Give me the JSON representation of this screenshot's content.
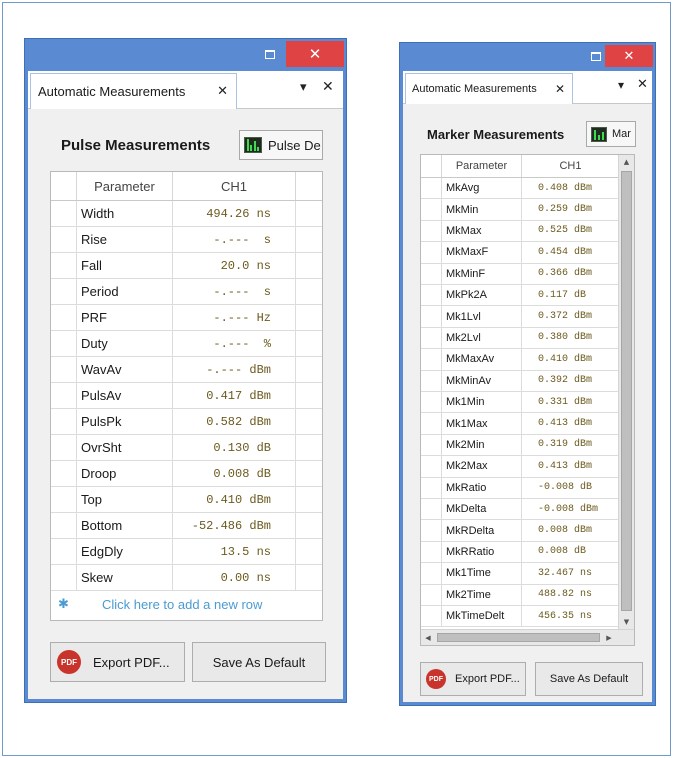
{
  "pulse_window": {
    "tab_title": "Automatic Measurements",
    "tab_close": "✕",
    "tab_dropdown": "▾",
    "tab_panel_close": "✕",
    "window_close": "✕",
    "section_title": "Pulse Measurements",
    "mode_combo": "Pulse De",
    "columns": [
      "Parameter",
      "CH1"
    ],
    "rows": [
      {
        "param": "Width",
        "value": "494.26 ns"
      },
      {
        "param": "Rise",
        "value": "-.---  s"
      },
      {
        "param": "Fall",
        "value": "20.0 ns"
      },
      {
        "param": "Period",
        "value": "-.---  s"
      },
      {
        "param": "PRF",
        "value": "-.--- Hz"
      },
      {
        "param": "Duty",
        "value": "-.---  %"
      },
      {
        "param": "WavAv",
        "value": "-.--- dBm"
      },
      {
        "param": "PulsAv",
        "value": "0.417 dBm"
      },
      {
        "param": "PulsPk",
        "value": "0.582 dBm"
      },
      {
        "param": "OvrSht",
        "value": "0.130 dB"
      },
      {
        "param": "Droop",
        "value": "0.008 dB"
      },
      {
        "param": "Top",
        "value": "0.410 dBm"
      },
      {
        "param": "Bottom",
        "value": "-52.486 dBm"
      },
      {
        "param": "EdgDly",
        "value": "13.5 ns"
      },
      {
        "param": "Skew",
        "value": "0.00 ns"
      }
    ],
    "add_row_text": "Click here to add a new row",
    "add_row_icon": "✱",
    "export_label": "Export PDF...",
    "export_icon_text": "PDF",
    "save_label": "Save As Default"
  },
  "marker_window": {
    "tab_title": "Automatic Measurements",
    "tab_close": "✕",
    "tab_dropdown": "▾",
    "tab_panel_close": "✕",
    "window_close": "✕",
    "section_title": "Marker Measurements",
    "mode_combo": "Mar",
    "columns": [
      "Parameter",
      "CH1"
    ],
    "rows": [
      {
        "param": "MkAvg",
        "value": "0.408 dBm"
      },
      {
        "param": "MkMin",
        "value": "0.259 dBm"
      },
      {
        "param": "MkMax",
        "value": "0.525 dBm"
      },
      {
        "param": "MkMaxF",
        "value": "0.454 dBm"
      },
      {
        "param": "MkMinF",
        "value": "0.366 dBm"
      },
      {
        "param": "MkPk2A",
        "value": "0.117 dB"
      },
      {
        "param": "Mk1Lvl",
        "value": "0.372 dBm"
      },
      {
        "param": "Mk2Lvl",
        "value": "0.380 dBm"
      },
      {
        "param": "MkMaxAv",
        "value": "0.410 dBm"
      },
      {
        "param": "MkMinAv",
        "value": "0.392 dBm"
      },
      {
        "param": "Mk1Min",
        "value": "0.331 dBm"
      },
      {
        "param": "Mk1Max",
        "value": "0.413 dBm"
      },
      {
        "param": "Mk2Min",
        "value": "0.319 dBm"
      },
      {
        "param": "Mk2Max",
        "value": "0.413 dBm"
      },
      {
        "param": "MkRatio",
        "value": "-0.008 dB"
      },
      {
        "param": "MkDelta",
        "value": "-0.008 dBm"
      },
      {
        "param": "MkRDelta",
        "value": "0.008 dBm"
      },
      {
        "param": "MkRRatio",
        "value": "0.008 dB"
      },
      {
        "param": "Mk1Time",
        "value": "32.467 ns"
      },
      {
        "param": "Mk2Time",
        "value": "488.82 ns"
      },
      {
        "param": "MkTimeDelt",
        "value": "456.35 ns"
      }
    ],
    "scroll_up": "▲",
    "scroll_down": "▼",
    "scroll_left": "◀",
    "scroll_right": "▶",
    "export_label": "Export PDF...",
    "export_icon_text": "PDF",
    "save_label": "Save As Default"
  },
  "colors": {
    "window_frame": "#5a8ad1",
    "close_button": "#e04343",
    "value_text": "#6b5a1e",
    "add_row_text": "#4a9bd1",
    "chart_icon_green": "#3ddc4f"
  }
}
